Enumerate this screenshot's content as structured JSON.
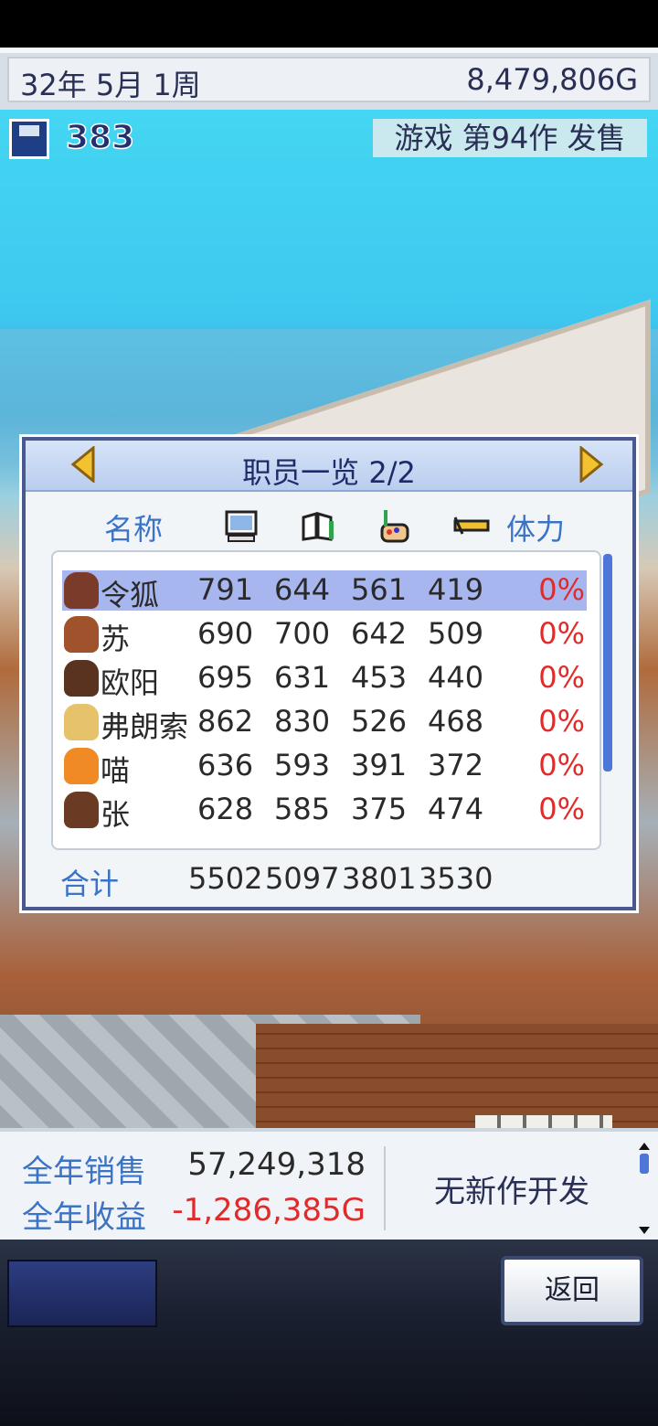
{
  "status_bar": {
    "date": "32年 5月 1周",
    "money": "8,479,806G"
  },
  "hud": {
    "disk_count": "383",
    "release_text": "游戏 第94作 发售"
  },
  "dialog": {
    "title": "职员一览 2/2",
    "columns": {
      "name": "名称",
      "stamina": "体力",
      "icons": [
        "computer-icon",
        "book-icon",
        "paint-icon",
        "audio-icon"
      ]
    },
    "staff": [
      {
        "name": "令狐",
        "v1": "791",
        "v2": "644",
        "v3": "561",
        "v4": "419",
        "stamina": "0%",
        "selected": true
      },
      {
        "name": "苏",
        "v1": "690",
        "v2": "700",
        "v3": "642",
        "v4": "509",
        "stamina": "0%"
      },
      {
        "name": "欧阳",
        "v1": "695",
        "v2": "631",
        "v3": "453",
        "v4": "440",
        "stamina": "0%"
      },
      {
        "name": "弗朗索",
        "v1": "862",
        "v2": "830",
        "v3": "526",
        "v4": "468",
        "stamina": "0%"
      },
      {
        "name": "喵",
        "v1": "636",
        "v2": "593",
        "v3": "391",
        "v4": "372",
        "stamina": "0%"
      },
      {
        "name": "张",
        "v1": "628",
        "v2": "585",
        "v3": "375",
        "v4": "474",
        "stamina": "0%"
      }
    ],
    "total_label": "合计",
    "totals": [
      "5502",
      "5097",
      "3801",
      "3530"
    ]
  },
  "info": {
    "annual_sales_label": "全年销售",
    "annual_sales": "57,249,318",
    "annual_profit_label": "全年收益",
    "annual_profit": "-1,286,385G",
    "dev_status": "无新作开发"
  },
  "footer": {
    "back_label": "返回"
  },
  "colors": {
    "accent_blue": "#3b73c6",
    "negative_red": "#e02b2b",
    "frame_navy": "#4a5890"
  }
}
